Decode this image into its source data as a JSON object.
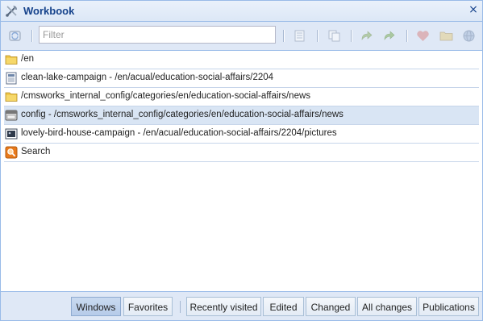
{
  "window": {
    "title": "Workbook",
    "close_glyph": "×"
  },
  "toolbar": {
    "filter_placeholder": "Filter",
    "icons": [
      "sync-icon",
      "document-icon",
      "copy-icon",
      "redo-icon",
      "forward-icon",
      "heart-icon",
      "folder-icon",
      "globe-icon"
    ]
  },
  "items": [
    {
      "label": "/en",
      "icon": "folder-icon"
    },
    {
      "label": "clean-lake-campaign - /en/acual/education-social-affairs/2204",
      "icon": "document-icon"
    },
    {
      "label": "/cmsworks_internal_config/categories/en/education-social-affairs/news",
      "icon": "folder-icon"
    },
    {
      "label": "config - /cmsworks_internal_config/categories/en/education-social-affairs/news",
      "icon": "config-icon",
      "selected": true
    },
    {
      "label": "lovely-bird-house-campaign - /en/acual/education-social-affairs/2204/pictures",
      "icon": "picture-icon"
    },
    {
      "label": "Search",
      "icon": "search-icon"
    }
  ],
  "tabs": [
    {
      "label": "Windows",
      "active": true
    },
    {
      "label": "Favorites"
    },
    {
      "label": "Recently visited"
    },
    {
      "label": "Edited"
    },
    {
      "label": "Changed"
    },
    {
      "label": "All changes"
    },
    {
      "label": "Publications"
    }
  ],
  "colors": {
    "title": "#15428b",
    "toolbar_bg": "#dfe8f6",
    "border": "#99bbe8",
    "selected_row": "#d9e5f4",
    "folder": "#f0c84a"
  }
}
